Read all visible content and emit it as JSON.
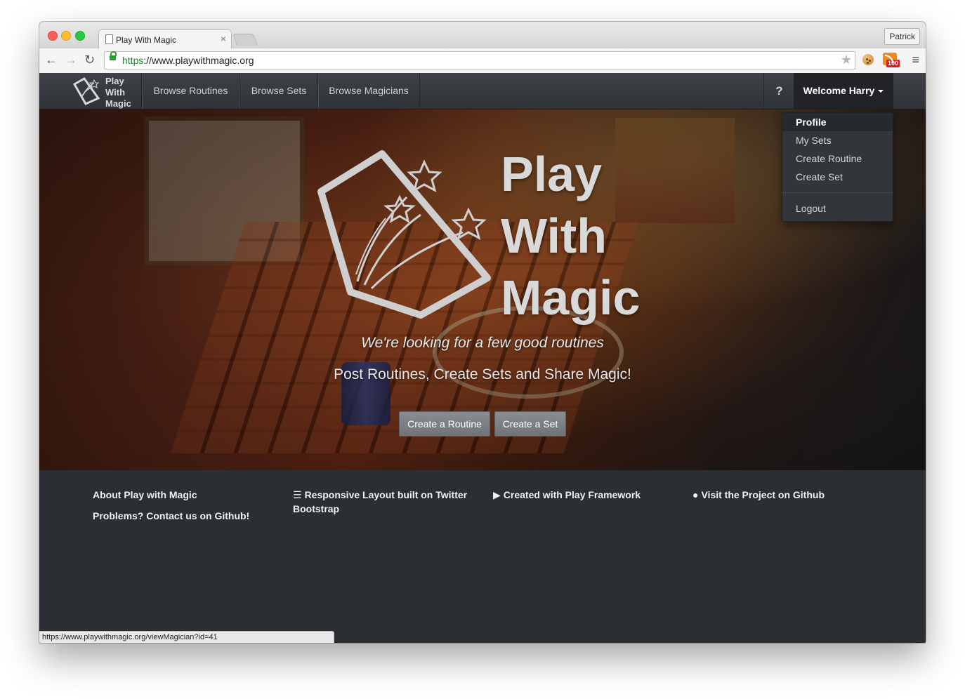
{
  "browser": {
    "tab_title": "Play With Magic",
    "tab_close": "×",
    "profile_name": "Patrick",
    "url_scheme": "https",
    "url_rest": "://www.playwithmagic.org",
    "back_icon": "arrow-left-icon",
    "forward_icon": "arrow-right-icon",
    "reload_icon": "reload-icon",
    "star_icon": "star-icon",
    "menu_icon": "hamburger-menu-icon",
    "rss_badge": "100",
    "status_url": "https://www.playwithmagic.org/viewMagician?id=41"
  },
  "navbar": {
    "brand_lines": [
      "Play",
      "With",
      "Magic"
    ],
    "items": [
      "Browse Routines",
      "Browse Sets",
      "Browse Magicians"
    ],
    "help_label": "?",
    "user_label": "Welcome Harry"
  },
  "dropdown": {
    "items": [
      "Profile",
      "My Sets",
      "Create Routine",
      "Create Set"
    ],
    "logout": "Logout"
  },
  "hero": {
    "title_lines": [
      "Play",
      "With",
      "Magic"
    ],
    "tagline": "We're looking for a few good routines",
    "subtitle": "Post Routines, Create Sets and Share Magic!",
    "buttons": [
      "Create a Routine",
      "Create a Set"
    ]
  },
  "footer": {
    "about": "About Play with Magic",
    "problems": "Problems? Contact us on Github!",
    "bootstrap": "Responsive Layout built on Twitter Bootstrap",
    "play": "Created with Play Framework",
    "github": "Visit the Project on Github"
  },
  "colors": {
    "navbar": "#35383d",
    "footer": "#2b2e33",
    "button": "#7c7f84",
    "url_green": "#1b8a29"
  }
}
